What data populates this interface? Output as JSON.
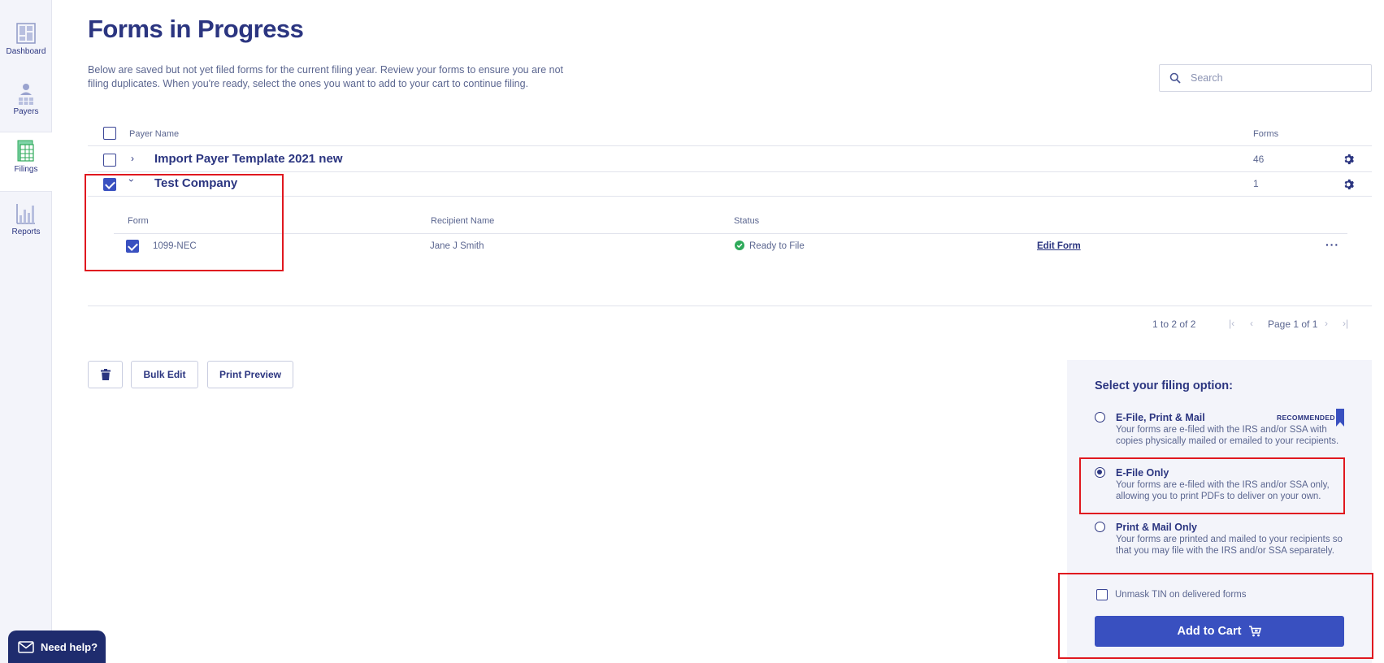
{
  "sidebar": {
    "items": [
      {
        "label": "Dashboard",
        "icon": "dashboard-icon"
      },
      {
        "label": "Payers",
        "icon": "payers-icon"
      },
      {
        "label": "Filings",
        "icon": "filings-icon",
        "active": true
      },
      {
        "label": "Reports",
        "icon": "reports-icon"
      }
    ],
    "help_label": "Need help?"
  },
  "page": {
    "title": "Forms in Progress",
    "description": "Below are saved but not yet filed forms for the current filing year. Review your forms to ensure you are not filing duplicates. When you're ready, select the ones you want to add to your cart to continue filing."
  },
  "search": {
    "placeholder": "Search",
    "value": ""
  },
  "table": {
    "headers": {
      "payer_name": "Payer Name",
      "forms": "Forms"
    },
    "rows": [
      {
        "payer": "Import Payer Template 2021 new",
        "forms": "46",
        "checked": false,
        "expanded": false
      },
      {
        "payer": "Test Company",
        "forms": "1",
        "checked": true,
        "expanded": true
      }
    ],
    "subtable": {
      "headers": {
        "form": "Form",
        "recipient": "Recipient Name",
        "status": "Status"
      },
      "rows": [
        {
          "form": "1099-NEC",
          "recipient": "Jane J Smith",
          "status": "Ready to File",
          "action": "Edit Form",
          "checked": true
        }
      ]
    }
  },
  "pagination": {
    "range": "1 to 2 of 2",
    "page": "Page 1 of 1"
  },
  "actions": {
    "bulk_edit": "Bulk Edit",
    "print_preview": "Print Preview"
  },
  "filing": {
    "title": "Select your filing option:",
    "recommended": "RECOMMENDED",
    "options": [
      {
        "title": "E-File, Print & Mail",
        "desc": "Your forms are e-filed with the IRS and/or SSA with copies physically mailed or emailed to your recipients.",
        "selected": false
      },
      {
        "title": "E-File Only",
        "desc": "Your forms are e-filed with the IRS and/or SSA only, allowing you to print PDFs to deliver on your own.",
        "selected": true
      },
      {
        "title": "Print & Mail Only",
        "desc": "Your forms are printed and mailed to your recipients so that you may file with the IRS and/or SSA separately.",
        "selected": false
      }
    ],
    "unmask_label": "Unmask TIN on delivered forms",
    "add_to_cart": "Add to Cart"
  },
  "colors": {
    "accent": "#3950c0",
    "navy": "#2b3580",
    "highlight": "#e0181f",
    "success": "#2eaa5a"
  }
}
